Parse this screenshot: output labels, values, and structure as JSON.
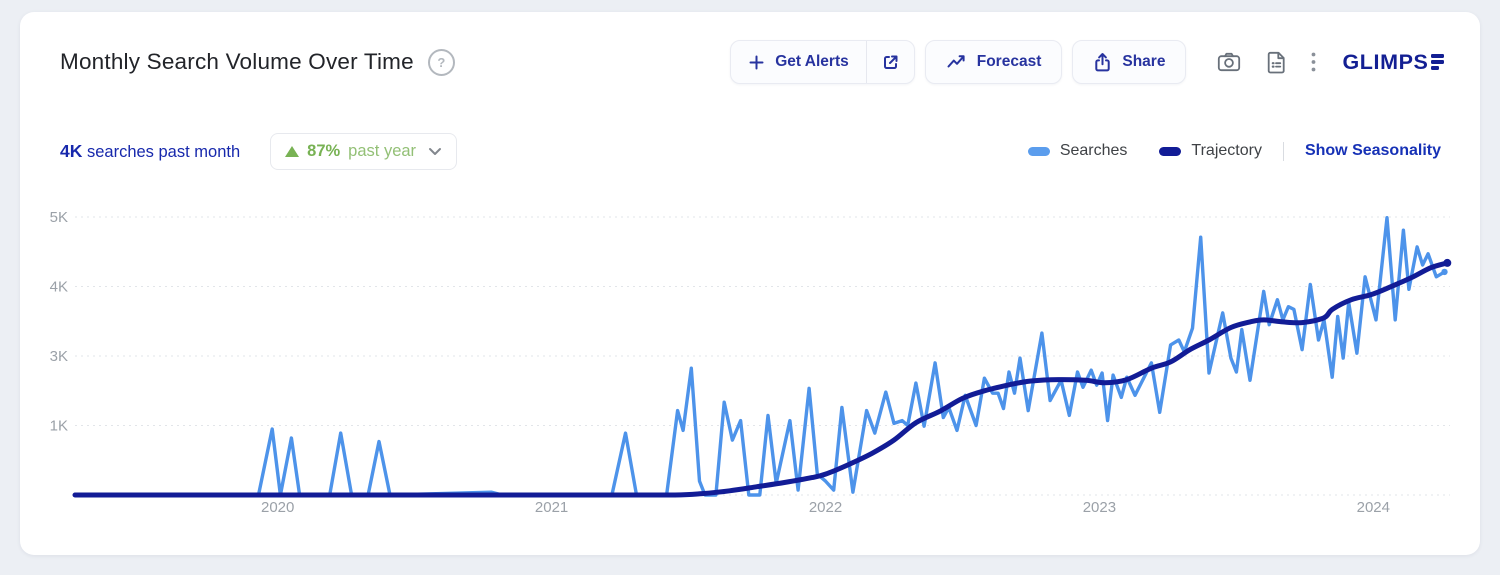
{
  "page": {
    "background": "#eceff4",
    "card_background": "#ffffff"
  },
  "header": {
    "title": "Monthly Search Volume Over Time",
    "help_glyph": "?",
    "actions": {
      "get_alerts_label": "Get Alerts",
      "forecast_label": "Forecast",
      "share_label": "Share"
    },
    "brand": {
      "name": "GLIMPSE",
      "display_text": "GLIMPS",
      "color": "#131f93"
    }
  },
  "stats": {
    "value": "4K",
    "label": "searches past month",
    "change": {
      "direction": "up",
      "percent": "87%",
      "period": "past year",
      "color": "#78b254"
    }
  },
  "legend": {
    "items": [
      {
        "label": "Searches",
        "color": "#4d93ea"
      },
      {
        "label": "Trajectory",
        "color": "#121c96"
      }
    ],
    "seasonality_label": "Show Seasonality"
  },
  "chart_data": {
    "type": "line",
    "title": "Monthly Search Volume Over Time",
    "units": "searches per month",
    "x_range": [
      2019.26,
      2024.28
    ],
    "x_ticks": [
      2020,
      2021,
      2022,
      2023,
      2024
    ],
    "y_ticks": [
      {
        "label": "5K",
        "value": 5000
      },
      {
        "label": "4K",
        "value": 4000
      },
      {
        "label": "3K",
        "value": 3000
      },
      {
        "label": "1K",
        "value": 1000
      }
    ],
    "y_baseline": 0,
    "grid": "horizontal-dashed",
    "legend_position": "top-right",
    "note": "y gridlines equally spaced as rendered; the 1K-3K interval spans a single gridline gap",
    "series": [
      {
        "name": "Searches",
        "color": "#4d93ea",
        "points": [
          [
            2019.26,
            0
          ],
          [
            2019.55,
            0
          ],
          [
            2019.93,
            0
          ],
          [
            2019.98,
            950
          ],
          [
            2020.01,
            0
          ],
          [
            2020.05,
            820
          ],
          [
            2020.08,
            0
          ],
          [
            2020.19,
            0
          ],
          [
            2020.23,
            890
          ],
          [
            2020.27,
            0
          ],
          [
            2020.33,
            0
          ],
          [
            2020.37,
            770
          ],
          [
            2020.41,
            0
          ],
          [
            2020.78,
            40
          ],
          [
            2020.82,
            0
          ],
          [
            2021.22,
            0
          ],
          [
            2021.27,
            890
          ],
          [
            2021.31,
            0
          ],
          [
            2021.42,
            0
          ],
          [
            2021.46,
            1430
          ],
          [
            2021.48,
            930
          ],
          [
            2021.51,
            2650
          ],
          [
            2021.54,
            200
          ],
          [
            2021.56,
            0
          ],
          [
            2021.6,
            0
          ],
          [
            2021.63,
            1670
          ],
          [
            2021.66,
            790
          ],
          [
            2021.69,
            1140
          ],
          [
            2021.72,
            0
          ],
          [
            2021.76,
            0
          ],
          [
            2021.79,
            1290
          ],
          [
            2021.82,
            170
          ],
          [
            2021.87,
            1140
          ],
          [
            2021.9,
            70
          ],
          [
            2021.94,
            2070
          ],
          [
            2021.97,
            300
          ],
          [
            2022.0,
            200
          ],
          [
            2022.03,
            70
          ],
          [
            2022.06,
            1520
          ],
          [
            2022.1,
            40
          ],
          [
            2022.15,
            1430
          ],
          [
            2022.18,
            890
          ],
          [
            2022.22,
            1960
          ],
          [
            2022.25,
            1060
          ],
          [
            2022.28,
            1140
          ],
          [
            2022.3,
            1000
          ],
          [
            2022.33,
            2220
          ],
          [
            2022.36,
            990
          ],
          [
            2022.4,
            2800
          ],
          [
            2022.43,
            1230
          ],
          [
            2022.45,
            1520
          ],
          [
            2022.48,
            930
          ],
          [
            2022.51,
            1870
          ],
          [
            2022.55,
            1000
          ],
          [
            2022.58,
            2360
          ],
          [
            2022.61,
            1930
          ],
          [
            2022.63,
            1930
          ],
          [
            2022.65,
            1490
          ],
          [
            2022.67,
            2540
          ],
          [
            2022.69,
            1930
          ],
          [
            2022.71,
            2940
          ],
          [
            2022.74,
            1430
          ],
          [
            2022.79,
            3330
          ],
          [
            2022.82,
            1720
          ],
          [
            2022.86,
            2300
          ],
          [
            2022.89,
            1290
          ],
          [
            2022.92,
            2540
          ],
          [
            2022.94,
            2100
          ],
          [
            2022.97,
            2590
          ],
          [
            2022.99,
            2160
          ],
          [
            2023.01,
            2510
          ],
          [
            2023.03,
            1140
          ],
          [
            2023.05,
            2450
          ],
          [
            2023.08,
            1810
          ],
          [
            2023.1,
            2390
          ],
          [
            2023.13,
            1870
          ],
          [
            2023.19,
            2800
          ],
          [
            2023.22,
            1380
          ],
          [
            2023.26,
            3160
          ],
          [
            2023.29,
            3230
          ],
          [
            2023.31,
            3060
          ],
          [
            2023.34,
            3400
          ],
          [
            2023.37,
            4710
          ],
          [
            2023.4,
            2510
          ],
          [
            2023.45,
            3620
          ],
          [
            2023.48,
            2940
          ],
          [
            2023.5,
            2540
          ],
          [
            2023.52,
            3380
          ],
          [
            2023.55,
            2300
          ],
          [
            2023.6,
            3930
          ],
          [
            2023.62,
            3450
          ],
          [
            2023.65,
            3810
          ],
          [
            2023.67,
            3520
          ],
          [
            2023.69,
            3710
          ],
          [
            2023.71,
            3670
          ],
          [
            2023.74,
            3090
          ],
          [
            2023.77,
            4030
          ],
          [
            2023.8,
            3230
          ],
          [
            2023.82,
            3520
          ],
          [
            2023.85,
            2390
          ],
          [
            2023.87,
            3570
          ],
          [
            2023.89,
            2940
          ],
          [
            2023.91,
            3770
          ],
          [
            2023.94,
            3040
          ],
          [
            2023.97,
            4140
          ],
          [
            2024.01,
            3520
          ],
          [
            2024.05,
            4990
          ],
          [
            2024.08,
            3520
          ],
          [
            2024.11,
            4810
          ],
          [
            2024.13,
            3960
          ],
          [
            2024.16,
            4570
          ],
          [
            2024.18,
            4310
          ],
          [
            2024.2,
            4470
          ],
          [
            2024.23,
            4140
          ],
          [
            2024.26,
            4210
          ]
        ]
      },
      {
        "name": "Trajectory",
        "color": "#121c96",
        "points": [
          [
            2019.26,
            0
          ],
          [
            2020.0,
            0
          ],
          [
            2020.7,
            0
          ],
          [
            2021.2,
            0
          ],
          [
            2021.45,
            0
          ],
          [
            2021.55,
            20
          ],
          [
            2021.65,
            60
          ],
          [
            2021.75,
            120
          ],
          [
            2021.85,
            180
          ],
          [
            2021.95,
            250
          ],
          [
            2022.0,
            300
          ],
          [
            2022.08,
            430
          ],
          [
            2022.17,
            600
          ],
          [
            2022.25,
            790
          ],
          [
            2022.33,
            1080
          ],
          [
            2022.42,
            1420
          ],
          [
            2022.5,
            1780
          ],
          [
            2022.58,
            2000
          ],
          [
            2022.67,
            2170
          ],
          [
            2022.75,
            2280
          ],
          [
            2022.85,
            2320
          ],
          [
            2022.95,
            2300
          ],
          [
            2023.02,
            2230
          ],
          [
            2023.1,
            2320
          ],
          [
            2023.19,
            2650
          ],
          [
            2023.26,
            2830
          ],
          [
            2023.33,
            3090
          ],
          [
            2023.4,
            3230
          ],
          [
            2023.48,
            3410
          ],
          [
            2023.55,
            3490
          ],
          [
            2023.6,
            3520
          ],
          [
            2023.67,
            3490
          ],
          [
            2023.74,
            3480
          ],
          [
            2023.82,
            3550
          ],
          [
            2023.85,
            3670
          ],
          [
            2023.92,
            3810
          ],
          [
            2023.99,
            3880
          ],
          [
            2024.06,
            3990
          ],
          [
            2024.14,
            4130
          ],
          [
            2024.21,
            4270
          ],
          [
            2024.27,
            4340
          ]
        ]
      }
    ]
  }
}
